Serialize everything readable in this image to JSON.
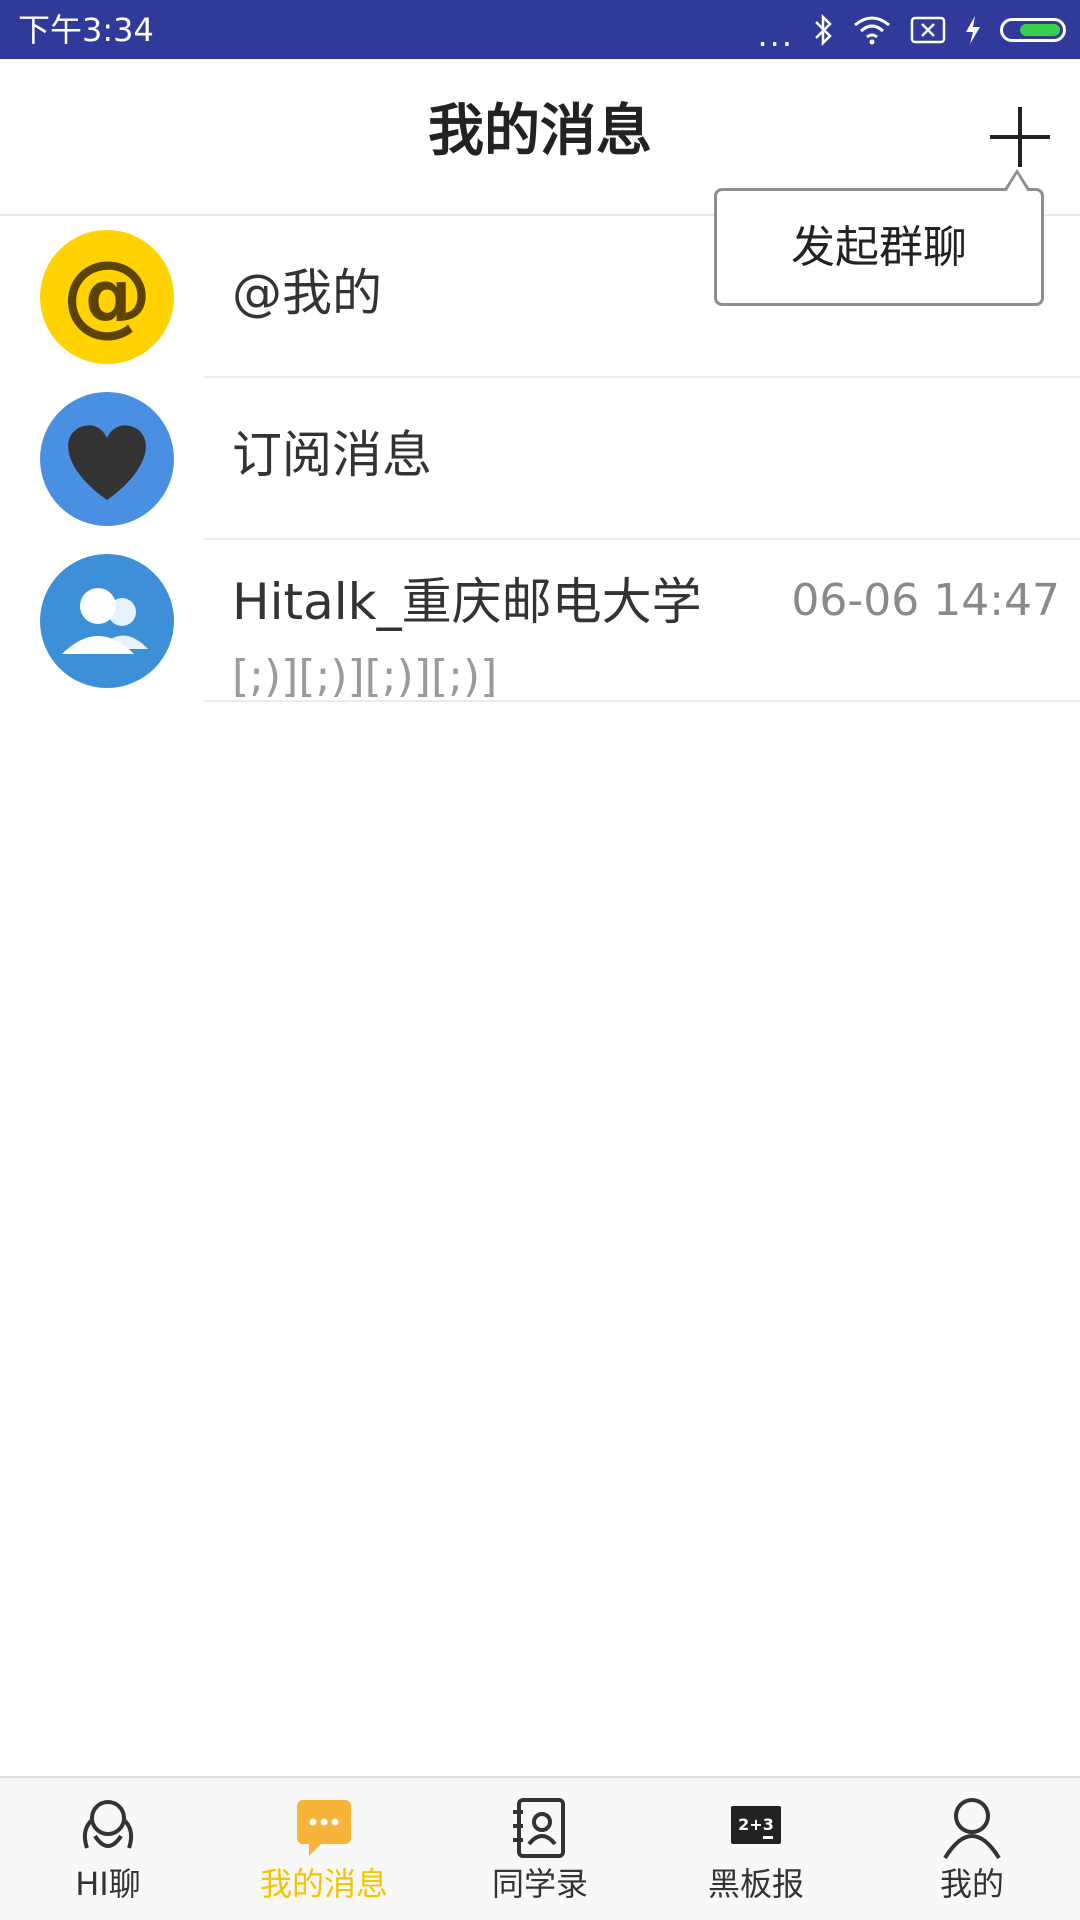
{
  "status_bar": {
    "time": "下午3:34",
    "dots": "...",
    "icons": [
      "bluetooth-icon",
      "wifi-icon",
      "sim-off-icon",
      "charging-icon",
      "battery-icon"
    ]
  },
  "header": {
    "title": "我的消息",
    "add_icon": "plus-icon"
  },
  "popup": {
    "label": "发起群聊"
  },
  "messages": [
    {
      "title": "@我的",
      "icon": "at-icon",
      "color": "#ffd200"
    },
    {
      "title": "订阅消息",
      "icon": "heart-icon",
      "color": "#4a90e2"
    },
    {
      "title": "Hitalk_重庆邮电大学",
      "subtitle": "[;)][;)][;)][;)]",
      "time": "06-06 14:47",
      "icon": "group-icon",
      "color": "#3d8fd8"
    }
  ],
  "tabs": [
    {
      "label": "HI聊",
      "icon": "hi-chat-icon",
      "active": false
    },
    {
      "label": "我的消息",
      "icon": "message-icon",
      "active": true
    },
    {
      "label": "同学录",
      "icon": "contacts-icon",
      "active": false
    },
    {
      "label": "黑板报",
      "icon": "blackboard-icon",
      "active": false,
      "icon_text": "2+3"
    },
    {
      "label": "我的",
      "icon": "profile-icon",
      "active": false
    }
  ],
  "colors": {
    "status_bar": "#2f3a9b",
    "accent": "#f5c400",
    "battery": "#36d04a"
  }
}
